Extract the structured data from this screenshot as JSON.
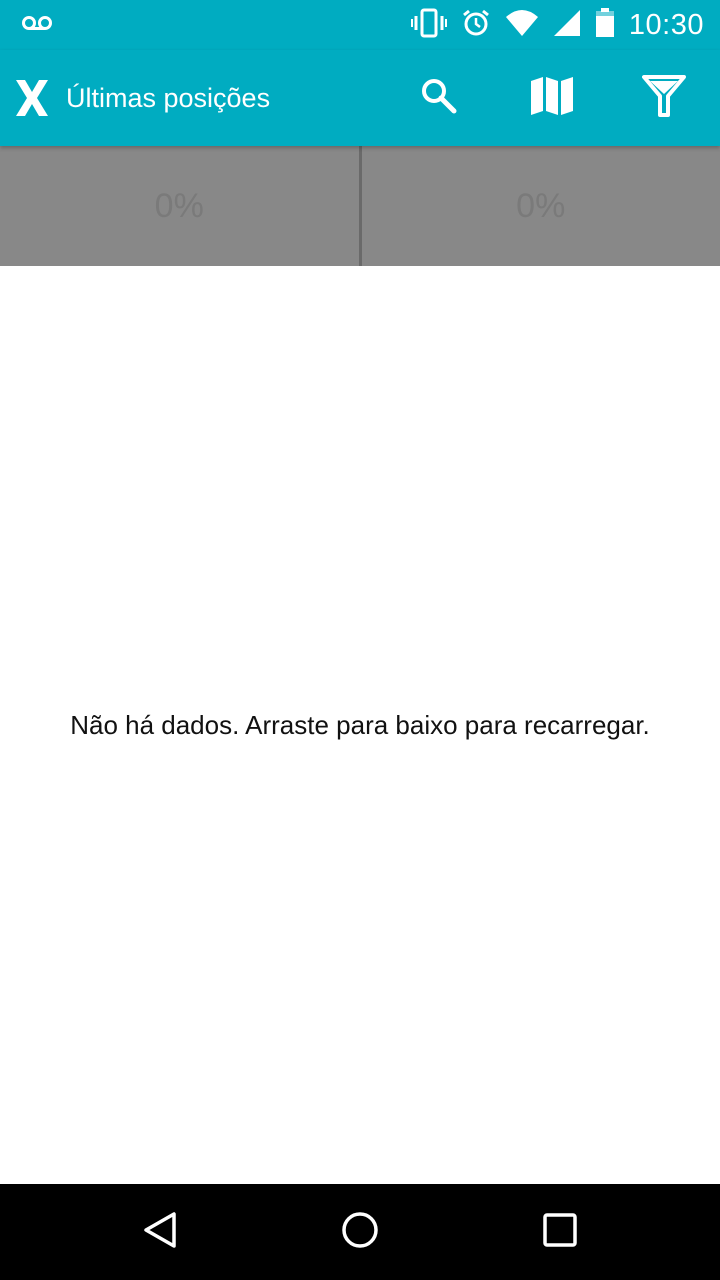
{
  "status_bar": {
    "time": "10:30",
    "icons": [
      "voicemail-icon",
      "vibrate-icon",
      "alarm-icon",
      "wifi-icon",
      "signal-icon",
      "battery-icon"
    ]
  },
  "app_bar": {
    "logo_icon": "x-logo-icon",
    "title": "Últimas posições",
    "actions": [
      "search-icon",
      "map-icon",
      "filter-icon"
    ],
    "color": "#00acc1"
  },
  "stats": {
    "left_value": "0%",
    "right_value": "0%"
  },
  "content": {
    "empty_message": "Não há dados. Arraste para baixo para recarregar."
  },
  "nav_bar": {
    "buttons": [
      "back-icon",
      "home-icon",
      "recents-icon"
    ]
  }
}
